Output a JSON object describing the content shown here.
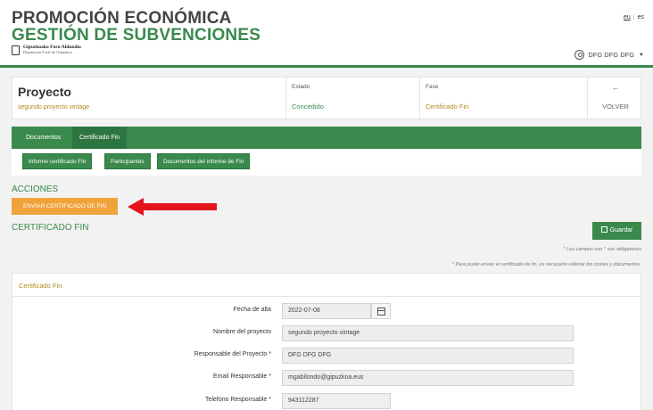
{
  "header": {
    "title_line1": "PROMOCIÓN ECONÓMICA",
    "title_line2": "GESTIÓN DE SUBVENCIONES",
    "logo_line1": "Gipuzkoako Foru Aldundia",
    "logo_line2": "Diputación Foral de Gipuzkoa",
    "lang_eu": "eu",
    "lang_es": "es",
    "user_name": "DFG DFG DFG",
    "user_caret": "▼"
  },
  "project": {
    "title": "Proyecto",
    "subtitle": "segundo proyecto vintage",
    "estado_label": "Estado",
    "estado_value": "Concedido",
    "fase_label": "Fase",
    "fase_value": "Certificado Fin",
    "back_arrow": "←",
    "back_label": "VOLVER"
  },
  "tabs": [
    "Documentos",
    "Certificado Fin"
  ],
  "subtabs": [
    "Informe certificado Fin",
    "Participantes",
    "Documentos del informe de Fin"
  ],
  "actions": {
    "heading": "ACCIONES",
    "send_button": "ENVIAR CERTIFICADO DE FIN"
  },
  "certificado": {
    "heading": "CERTIFICADO FIN",
    "save_button": "Guardar",
    "note_required": "* Los campos con * son obligatorios",
    "note_costs": "* Para poder enviar el certificado de fin, es necesario rellenar los costes y documentos.",
    "panel_title": "Certificado Fin"
  },
  "form": {
    "fecha_label": "Fecha de alta",
    "fecha_value": "2022-07-08",
    "nombre_label": "Nombre del proyecto",
    "nombre_value": "segundo proyecto vintage",
    "responsable_label": "Responsable del Proyecto *",
    "responsable_value": "DFG DFG DFG",
    "email_label": "Email Responsable *",
    "email_value": "mgabilondo@gipuzkoa.eus",
    "telefono_label": "Telefono Responsable *",
    "telefono_value": "943112287"
  },
  "colors": {
    "brand_green": "#3a8a4d",
    "accent_orange": "#f0a33a",
    "annotation_red": "#e3141b",
    "gold_text": "#b08a1f"
  }
}
